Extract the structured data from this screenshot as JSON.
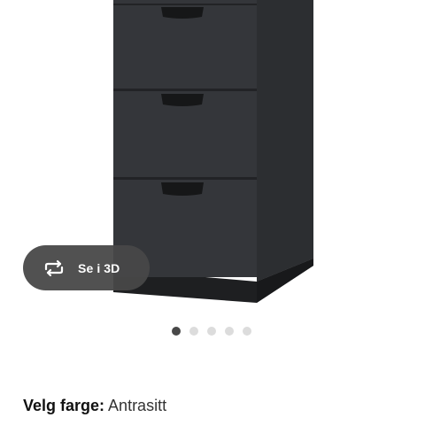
{
  "viewer": {
    "view_3d_label": "Se i 3D",
    "view_3d_icon": "rotate-3d-icon",
    "carousel": {
      "count": 5,
      "active_index": 0
    }
  },
  "product": {
    "color_key": "Velg farge:",
    "color_value": "Antrasitt"
  },
  "colors": {
    "dresser_front": "#34363a",
    "dresser_side": "#2c2e31",
    "handle": "#161718",
    "button_bg": "#484848",
    "dot_active": "#484848",
    "dot_inactive": "#dcdcdc"
  }
}
